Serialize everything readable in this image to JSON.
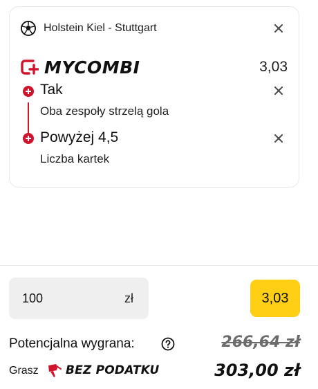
{
  "bet_card": {
    "match": "Holstein Kiel - Stuttgart",
    "combi_label": "MYCOMBI",
    "combi_odds": "3,03",
    "selections": [
      {
        "title": "Tak",
        "subtitle": "Oba zespoły strzelą gola"
      },
      {
        "title": "Powyżej 4,5",
        "subtitle": "Liczba kartek"
      }
    ]
  },
  "stake": {
    "value": "100",
    "currency": "zł"
  },
  "odds_button": "3,03",
  "summary": {
    "potential_win_label": "Potencjalna wygrana:",
    "old_amount": "266,64 zł",
    "play_label": "Grasz",
    "tax_free_label": "BEZ PODATKU",
    "new_amount": "303,00 zł"
  },
  "icons": {
    "sport": "soccer-ball-icon",
    "combi": "mycombi-logo-icon",
    "remove": "close-icon",
    "selection": "plus-circle-icon",
    "help": "question-circle-icon",
    "tax": "tax-free-icon"
  },
  "colors": {
    "accent_red": "#d0142c",
    "odds_yellow": "#ffcf16",
    "stake_bg": "#efefef"
  }
}
